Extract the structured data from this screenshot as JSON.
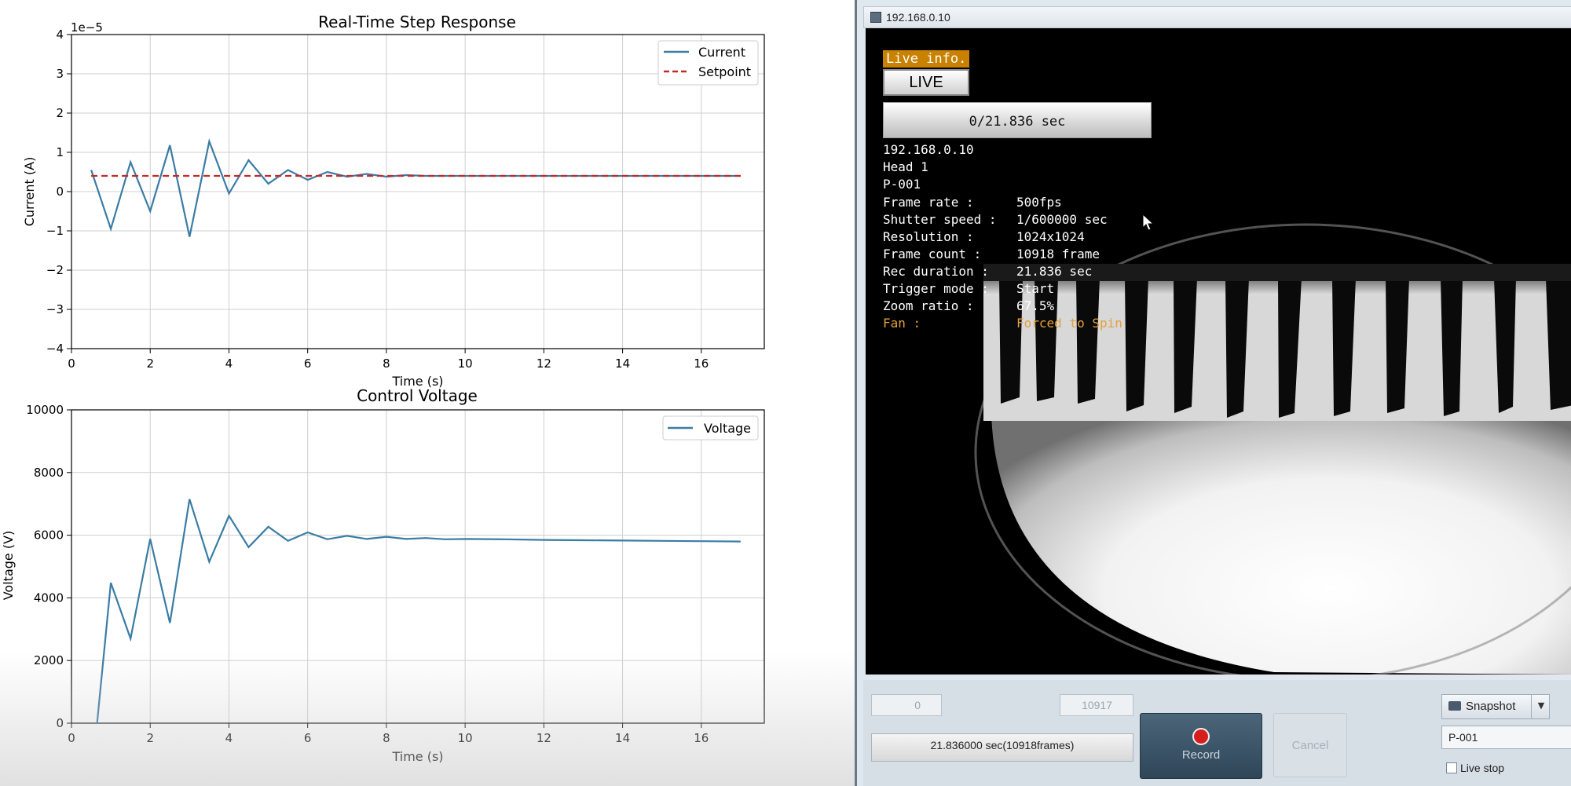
{
  "chart_data": [
    {
      "type": "line",
      "title": "Real-Time Step Response",
      "xlabel": "Time (s)",
      "ylabel": "Current (A)",
      "y_scale_label": "1e−5",
      "xlim": [
        0,
        17.6
      ],
      "ylim": [
        -4,
        4
      ],
      "x_ticks": [
        0,
        2,
        4,
        6,
        8,
        10,
        12,
        14,
        16
      ],
      "y_ticks": [
        -4,
        -3,
        -2,
        -1,
        0,
        1,
        2,
        3,
        4
      ],
      "y_tick_labels": [
        "−4",
        "−3",
        "−2",
        "−1",
        "0",
        "1",
        "2",
        "3",
        "4"
      ],
      "grid": true,
      "legend": "top-right",
      "series": [
        {
          "name": "Current",
          "color": "#3a7ca5",
          "style": "solid",
          "x": [
            0.5,
            1.0,
            1.5,
            2.0,
            2.5,
            3.0,
            3.5,
            4.0,
            4.5,
            5.0,
            5.5,
            6.0,
            6.5,
            7.0,
            7.5,
            8.0,
            8.5,
            9.0,
            17.0
          ],
          "y": [
            0.55,
            -0.95,
            0.75,
            -0.5,
            1.18,
            -1.15,
            1.28,
            -0.05,
            0.8,
            0.2,
            0.55,
            0.3,
            0.5,
            0.38,
            0.45,
            0.38,
            0.42,
            0.4,
            0.4
          ]
        },
        {
          "name": "Setpoint",
          "color": "#c42a2a",
          "style": "dashed",
          "x": [
            0.5,
            17.0
          ],
          "y": [
            0.4,
            0.4
          ]
        }
      ]
    },
    {
      "type": "line",
      "title": "Control Voltage",
      "xlabel": "Time (s)",
      "ylabel": "Voltage (V)",
      "xlim": [
        0,
        17.6
      ],
      "ylim": [
        0,
        10000
      ],
      "x_ticks": [
        0,
        2,
        4,
        6,
        8,
        10,
        12,
        14,
        16
      ],
      "y_ticks": [
        0,
        2000,
        4000,
        6000,
        8000,
        10000
      ],
      "grid": true,
      "legend": "top-right",
      "series": [
        {
          "name": "Voltage",
          "color": "#3a7ca5",
          "style": "solid",
          "x": [
            0.5,
            0.65,
            1.0,
            1.5,
            2.0,
            2.5,
            3.0,
            3.5,
            4.0,
            4.5,
            5.0,
            5.5,
            6.0,
            6.5,
            7.0,
            7.5,
            8.0,
            8.5,
            9.0,
            9.5,
            10.0,
            11.0,
            12.0,
            13.0,
            14.0,
            15.0,
            16.0,
            17.0
          ],
          "y": [
            -800,
            0,
            4480,
            2700,
            5880,
            3200,
            7150,
            5150,
            6620,
            5620,
            6270,
            5820,
            6090,
            5870,
            5980,
            5880,
            5950,
            5880,
            5910,
            5870,
            5880,
            5870,
            5850,
            5840,
            5830,
            5820,
            5810,
            5800
          ]
        }
      ]
    }
  ],
  "camera_window": {
    "title": "192.168.0.10",
    "osd": {
      "badge": "Live info.",
      "live_button": "LIVE",
      "time_bar": "0/21.836 sec",
      "header_lines": [
        "192.168.0.10",
        "Head 1",
        "P-001"
      ],
      "rows": [
        {
          "key": "Frame rate :",
          "value": "500fps"
        },
        {
          "key": "Shutter speed :",
          "value": "1/600000 sec"
        },
        {
          "key": "Resolution :",
          "value": "1024x1024"
        },
        {
          "key": "Frame count :",
          "value": "10918 frame"
        },
        {
          "key": "Rec duration :",
          "value": "21.836 sec"
        },
        {
          "key": "Trigger mode :",
          "value": "Start"
        },
        {
          "key": "Zoom ratio :",
          "value": "67.5%"
        }
      ],
      "fan_row": {
        "key": "Fan :",
        "value": "Forced to Spin"
      }
    },
    "controls": {
      "start_frame": "0",
      "end_frame": "10917",
      "duration_text": "21.836000 sec(10918frames)",
      "record_label": "Record",
      "cancel_label": "Cancel",
      "snapshot_label": "Snapshot",
      "head_select": "P-001",
      "live_stop_label": "Live stop"
    }
  }
}
